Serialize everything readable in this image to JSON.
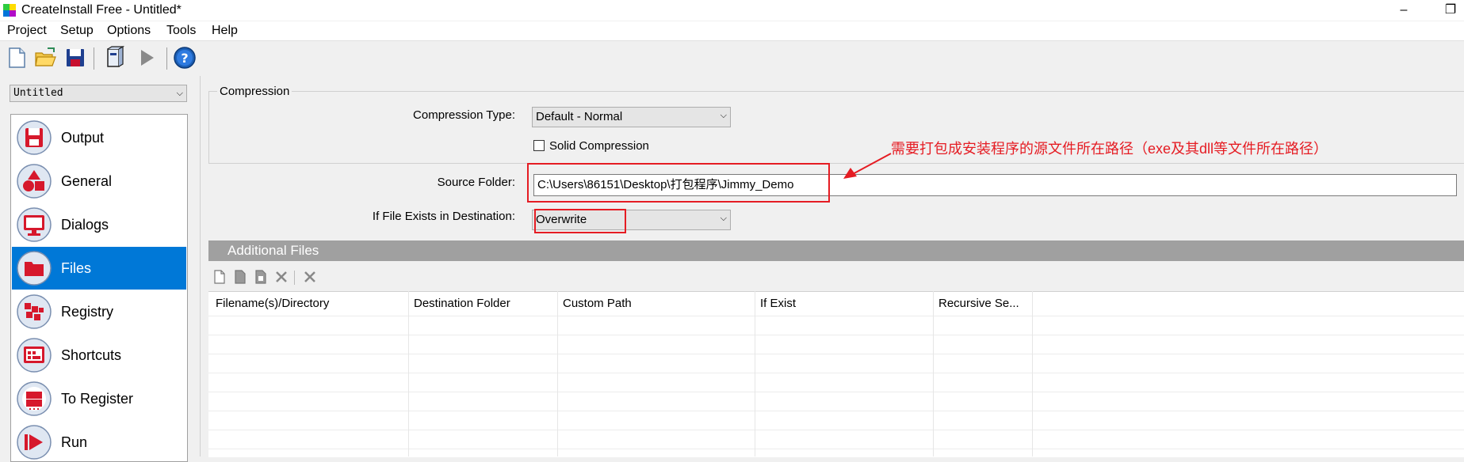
{
  "window": {
    "title": "CreateInstall Free - Untitled*",
    "minimize_glyph": "–",
    "restore_glyph": "❐"
  },
  "menu": [
    "Project",
    "Setup",
    "Options",
    "Tools",
    "Help"
  ],
  "toolbar_icons": [
    "new-file-icon",
    "open-folder-icon",
    "save-icon",
    "build-icon",
    "run-icon",
    "help-icon"
  ],
  "project_selector": {
    "value": "Untitled"
  },
  "nav": {
    "items": [
      {
        "label": "Output",
        "icon": "output-icon"
      },
      {
        "label": "General",
        "icon": "general-icon"
      },
      {
        "label": "Dialogs",
        "icon": "dialogs-icon"
      },
      {
        "label": "Files",
        "icon": "files-icon",
        "selected": true
      },
      {
        "label": "Registry",
        "icon": "registry-icon"
      },
      {
        "label": "Shortcuts",
        "icon": "shortcuts-icon"
      },
      {
        "label": "To Register",
        "icon": "to-register-icon"
      },
      {
        "label": "Run",
        "icon": "run-icon"
      }
    ]
  },
  "compression": {
    "group_title": "Compression",
    "type_label": "Compression Type:",
    "type_value": "Default - Normal",
    "solid_label": "Solid Compression",
    "solid_checked": false
  },
  "source": {
    "label": "Source Folder:",
    "value": "C:\\Users\\86151\\Desktop\\打包程序\\Jimmy_Demo"
  },
  "if_exists": {
    "label": "If File Exists in Destination:",
    "value": "Overwrite"
  },
  "annotation": {
    "text": "需要打包成安装程序的源文件所在路径（exe及其dll等文件所在路径）",
    "color": "#e51c23"
  },
  "additional_files": {
    "title": "Additional Files",
    "columns": [
      "Filename(s)/Directory",
      "Destination Folder",
      "Custom Path",
      "If Exist",
      "Recursive Se..."
    ]
  },
  "colors": {
    "selected": "#0078d7",
    "accent_red": "#e51c23"
  }
}
